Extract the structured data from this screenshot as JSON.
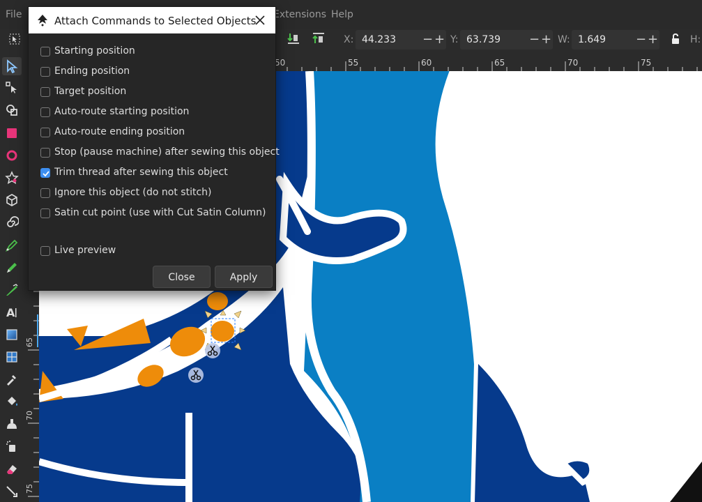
{
  "menubar": {
    "items": [
      {
        "label": "File"
      },
      {
        "label": "Extensions"
      },
      {
        "label": "Help"
      }
    ]
  },
  "toolcontrols": {
    "x_label": "X:",
    "x_value": "44.233",
    "y_label": "Y:",
    "y_value": "63.739",
    "w_label": "W:",
    "w_value": "1.649",
    "h_label": "H:"
  },
  "rulers": {
    "horizontal": [
      "50",
      "55",
      "60",
      "65",
      "70",
      "75"
    ],
    "vertical": [
      "65",
      "70",
      "75"
    ]
  },
  "dialog": {
    "title": "Attach Commands to Selected Objects",
    "options": [
      {
        "label": "Starting position",
        "checked": false
      },
      {
        "label": "Ending position",
        "checked": false
      },
      {
        "label": "Target position",
        "checked": false
      },
      {
        "label": "Auto-route starting position",
        "checked": false
      },
      {
        "label": "Auto-route ending position",
        "checked": false
      },
      {
        "label": "Stop (pause machine) after sewing this object",
        "checked": false
      },
      {
        "label": "Trim thread after sewing this object",
        "checked": true
      },
      {
        "label": "Ignore this object (do not stitch)",
        "checked": false
      },
      {
        "label": "Satin cut point (use with Cut Satin Column)",
        "checked": false
      }
    ],
    "live_preview": {
      "label": "Live preview",
      "checked": false
    },
    "close_label": "Close",
    "apply_label": "Apply"
  },
  "colors": {
    "dark_blue": "#063a8c",
    "light_blue": "#0a7fc4",
    "orange": "#ee8c0a",
    "accent": "#3d8ef0"
  },
  "icons": {
    "canvas_markers": [
      "scissors-icon",
      "scissors-icon"
    ]
  }
}
